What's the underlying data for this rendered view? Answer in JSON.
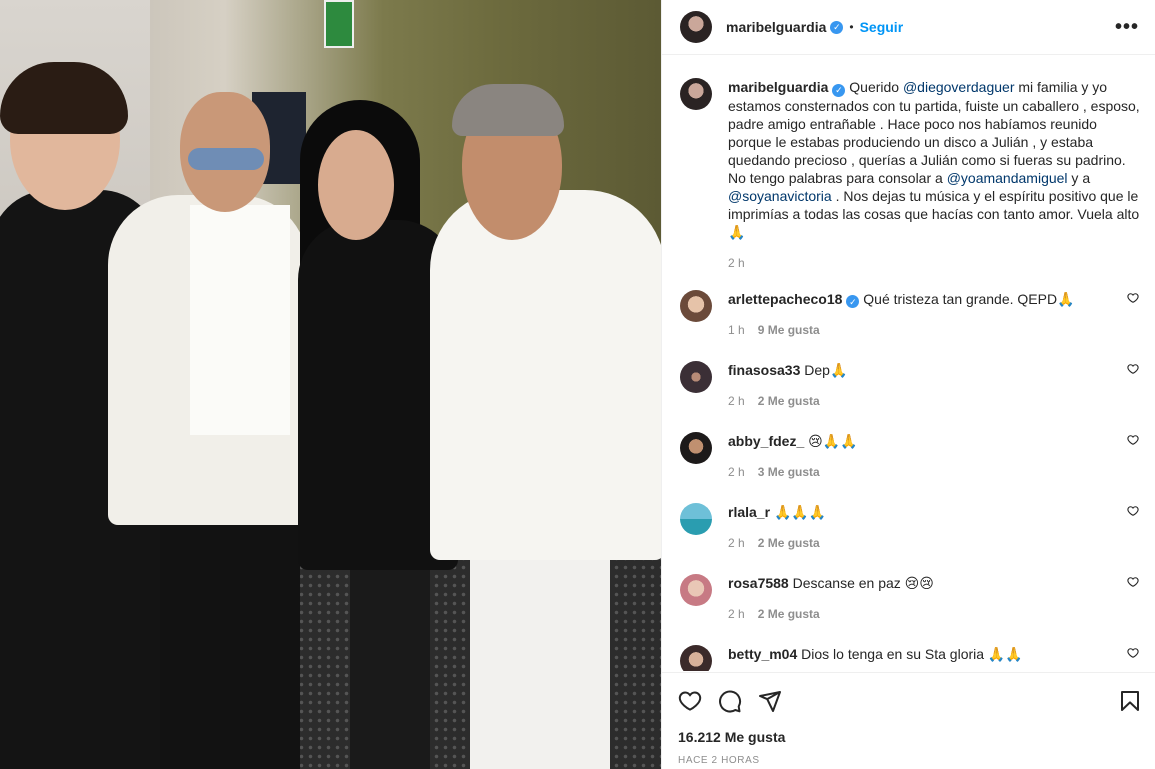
{
  "post": {
    "author": "maribelguardia",
    "follow_label": "Seguir",
    "dot": "•",
    "more": "•••"
  },
  "caption": {
    "author": "maribelguardia",
    "part1": "Querido ",
    "mention1": "@diegoverdaguer",
    "part2": " mi familia y yo estamos consternados con tu partida, fuiste un caballero , esposo, padre amigo entrañable . Hace poco nos habíamos reunido porque le estabas produciendo un disco a Julián , y estaba quedando precioso , querías a Julián como si fueras su padrino. No tengo palabras para consolar a ",
    "mention2": "@yoamandamiguel",
    "part3": " y a ",
    "mention3": "@soyanavictoria",
    "part4": " . Nos dejas tu música y el espíritu positivo que le imprimías a todas las cosas que hacías con tanto amor. Vuela alto 🙏",
    "time": "2 h"
  },
  "comments": [
    {
      "user": "arlettepacheco18",
      "verified": true,
      "text": "Qué tristeza tan grande. QEPD🙏",
      "time": "1 h",
      "likes": "9 Me gusta"
    },
    {
      "user": "finasosa33",
      "text": "Dep🙏",
      "time": "2 h",
      "likes": "2 Me gusta"
    },
    {
      "user": "abby_fdez_",
      "text": "😢🙏🙏",
      "time": "2 h",
      "likes": "3 Me gusta"
    },
    {
      "user": "rlala_r",
      "text": "🙏🙏🙏",
      "time": "2 h",
      "likes": "2 Me gusta"
    },
    {
      "user": "rosa7588",
      "text": "Descanse en paz 😢😢",
      "time": "2 h",
      "likes": "2 Me gusta"
    },
    {
      "user": "betty_m04",
      "text": "Dios lo tenga en su Sta gloria 🙏🙏",
      "time": "",
      "likes": ""
    }
  ],
  "footer": {
    "likes_total": "16.212 Me gusta",
    "time_ago": "HACE 2 HORAS"
  },
  "icons": {
    "verified": "✓"
  },
  "colors": {
    "accent": "#0095f6",
    "verified": "#3897f0",
    "mention": "#00376b",
    "muted": "#8e8e8e"
  }
}
